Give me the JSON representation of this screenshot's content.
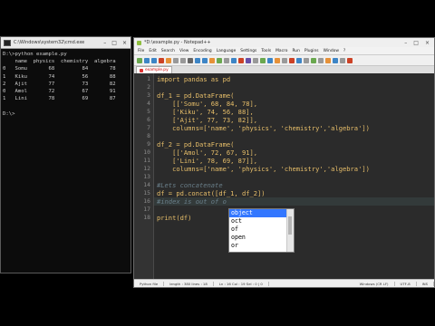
{
  "console": {
    "title": "C:\\Windows\\system32\\cmd.exe",
    "lines": [
      "D:\\>python example.py",
      "    name  physics  chemistry  algebra",
      "0   Somu       68         84       78",
      "1   Kiku       74         56       88",
      "2   Ajit       77         73       82",
      "0   Amol       72         67       91",
      "1   Lini       78         69       87",
      "",
      "D:\\>"
    ]
  },
  "npp": {
    "title": "*D:\\example.py - Notepad++",
    "menu": [
      "File",
      "Edit",
      "Search",
      "View",
      "Encoding",
      "Language",
      "Settings",
      "Tools",
      "Macro",
      "Run",
      "Plugins",
      "Window",
      "?"
    ],
    "tab_label": "example.py",
    "code": [
      {
        "n": "1",
        "t": "import pandas as pd",
        "c": false
      },
      {
        "n": "2",
        "t": "",
        "c": false
      },
      {
        "n": "3",
        "t": "df_1 = pd.DataFrame(",
        "c": false
      },
      {
        "n": "4",
        "t": "    [['Somu', 68, 84, 78],",
        "c": false
      },
      {
        "n": "5",
        "t": "    ['Kiku', 74, 56, 88],",
        "c": false
      },
      {
        "n": "6",
        "t": "    ['Ajit', 77, 73, 82]],",
        "c": false
      },
      {
        "n": "7",
        "t": "    columns=['name', 'physics', 'chemistry','algebra'])",
        "c": false
      },
      {
        "n": "8",
        "t": "",
        "c": false
      },
      {
        "n": "9",
        "t": "df_2 = pd.DataFrame(",
        "c": false
      },
      {
        "n": "10",
        "t": "    [['Amol', 72, 67, 91],",
        "c": false
      },
      {
        "n": "11",
        "t": "    ['Lini', 78, 69, 87]],",
        "c": false
      },
      {
        "n": "12",
        "t": "    columns=['name', 'physics', 'chemistry','algebra'])",
        "c": false
      },
      {
        "n": "13",
        "t": "",
        "c": false
      },
      {
        "n": "14",
        "t": "#Lets concatenate",
        "c": true
      },
      {
        "n": "15",
        "t": "df = pd.concat([df_1, df_2])",
        "c": false
      },
      {
        "n": "16",
        "t": "#index is out of o",
        "c": true
      },
      {
        "n": "17",
        "t": "",
        "c": false
      },
      {
        "n": "18",
        "t": "print(df)",
        "c": false
      }
    ],
    "autocomplete": [
      "object",
      "oct",
      "of",
      "open",
      "or"
    ],
    "status": [
      "Python file",
      "length : 380    lines : 18",
      "Ln : 16    Col : 19    Sel : 0 | 0",
      "Windows (CR LF)",
      "UTF-8",
      "INS"
    ]
  },
  "colors": {
    "keyword_text": "#e8bf6a",
    "comment": "#6a7f8a",
    "editor_bg": "#2b2b2b",
    "selection": "#3377ff"
  }
}
